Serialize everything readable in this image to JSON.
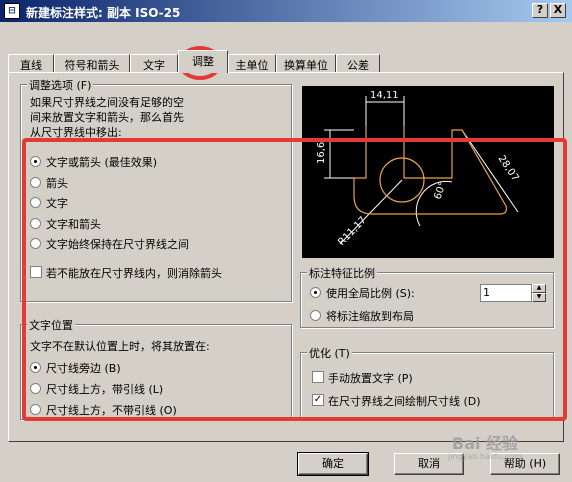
{
  "window": {
    "title": "新建标注样式: 副本 ISO-25",
    "help_btn": "?",
    "close_btn": "X",
    "app_icon": "dimension-style-icon"
  },
  "tabs": [
    "直线",
    "符号和箭头",
    "文字",
    "调整",
    "主单位",
    "换算单位",
    "公差"
  ],
  "active_tab": 3,
  "fit_options": {
    "title": "调整选项 (F)",
    "desc_1": "如果尺寸界线之间没有足够的空",
    "desc_2": "间来放置文字和箭头，那么首先",
    "desc_3": "从尺寸界线中移出:",
    "options": [
      "文字或箭头 (最佳效果)",
      "箭头",
      "文字",
      "文字和箭头",
      "文字始终保持在尺寸界线之间"
    ],
    "selected": 0,
    "suppress_label": "若不能放在尺寸界线内，则消除箭头",
    "suppress_checked": false
  },
  "text_placement": {
    "title": "文字位置",
    "desc": "文字不在默认位置上时，将其放置在:",
    "options": [
      "尺寸线旁边 (B)",
      "尺寸线上方，带引线 (L)",
      "尺寸线上方，不带引线 (O)"
    ],
    "selected": 0
  },
  "scale": {
    "title": "标注特征比例",
    "use_overall": "使用全局比例 (S):",
    "scale_value": "1",
    "scale_to_layout": "将标注缩放到布局",
    "selected": 0
  },
  "fine_tuning": {
    "title": "优化 (T)",
    "manual_place": "手动放置文字 (P)",
    "manual_checked": false,
    "draw_dim_line": "在尺寸界线之间绘制尺寸线 (D)",
    "draw_checked": true
  },
  "preview": {
    "dim_top": "14,11",
    "dim_left": "16,6",
    "dim_right": "28,07",
    "dim_angle": "60°",
    "dim_radius": "R11,17"
  },
  "buttons": {
    "ok": "确定",
    "cancel": "取消",
    "help": "帮助 (H)"
  },
  "watermark": {
    "text": "Bai 经验",
    "sub": "jingyan.baidu.com"
  }
}
